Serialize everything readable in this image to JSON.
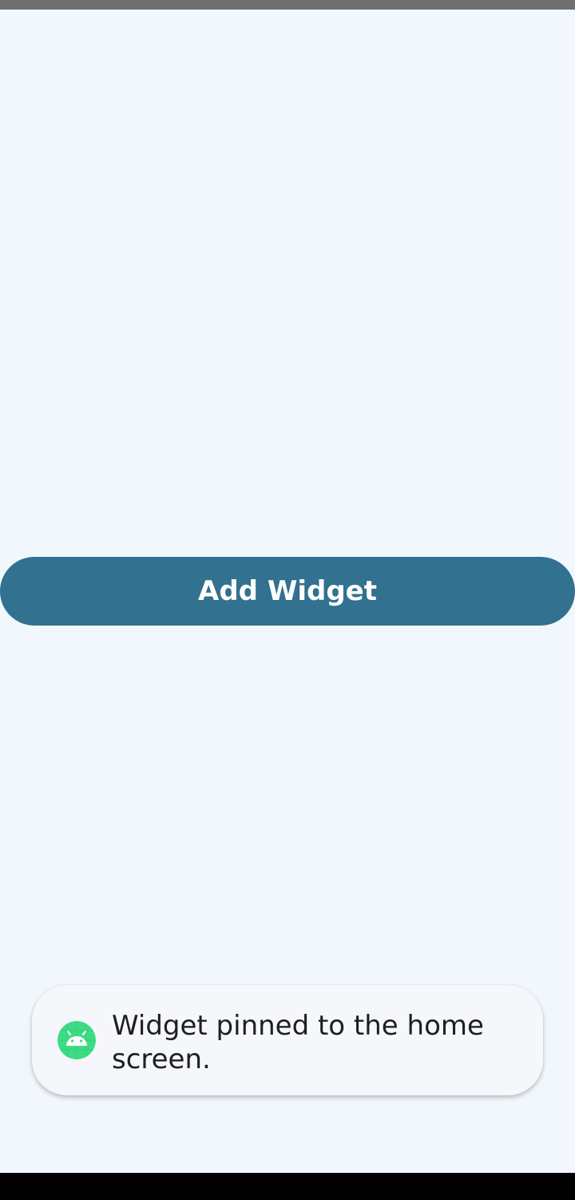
{
  "main": {
    "add_widget_label": "Add Widget"
  },
  "toast": {
    "message": "Widget pinned to the home screen.",
    "icon": "android-icon"
  },
  "colors": {
    "background": "#f1f7fd",
    "button": "#32718f",
    "toast_background": "#f5f7fb",
    "android_green": "#3ddc84"
  }
}
